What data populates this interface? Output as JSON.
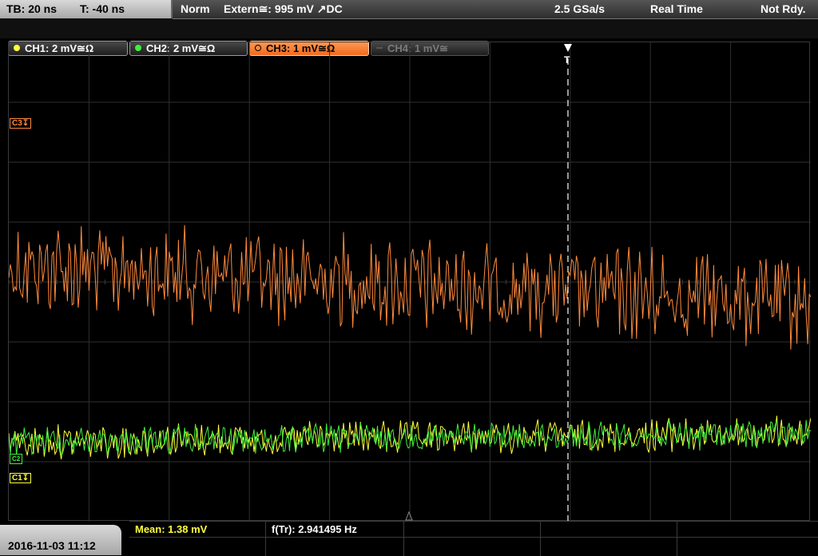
{
  "status_bar": {
    "timebase": "TB: 20 ns",
    "trigger_time": "T: -40 ns",
    "trigger_mode": "Norm",
    "trigger_source": "Extern≅: 995 mV ↗DC",
    "sample_rate": "2.5 GSa/s",
    "acquisition_mode": "Real Time",
    "status": "Not Rdy."
  },
  "channels": [
    {
      "label": "CH1: 2 mV≅Ω",
      "color": "#ffff3a",
      "state": "on"
    },
    {
      "label": "CH2: 2 mV≅Ω",
      "color": "#3ef03e",
      "state": "on"
    },
    {
      "label": "CH3: 1 mV≅Ω",
      "color": "#ff8a3c",
      "state": "selected"
    },
    {
      "label": "CH4: 1 mV≅",
      "color": "#7a7a7a",
      "state": "off"
    }
  ],
  "markers": {
    "c3": "C3",
    "c1": "C1",
    "c2": "C2",
    "trigger": "T"
  },
  "footer": {
    "datetime": "2016-11-03 11:12",
    "mean": "Mean: 1.38 mV",
    "freq": "f(Tr): 2.941495 Hz"
  },
  "colors": {
    "ch1": "#ffff3a",
    "ch2": "#3ef03e",
    "ch3": "#ff8a3c",
    "grid": "#2f2f2f"
  }
}
